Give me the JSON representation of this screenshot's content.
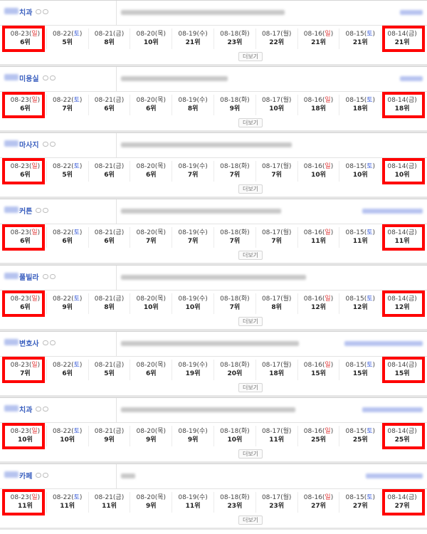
{
  "dates": [
    {
      "md": "08-23",
      "dow": "일",
      "type": "sun"
    },
    {
      "md": "08-22",
      "dow": "토",
      "type": "sat"
    },
    {
      "md": "08-21",
      "dow": "금",
      "type": "weekday"
    },
    {
      "md": "08-20",
      "dow": "목",
      "type": "weekday"
    },
    {
      "md": "08-19",
      "dow": "수",
      "type": "weekday"
    },
    {
      "md": "08-18",
      "dow": "화",
      "type": "weekday"
    },
    {
      "md": "08-17",
      "dow": "월",
      "type": "weekday"
    },
    {
      "md": "08-16",
      "dow": "일",
      "type": "sun"
    },
    {
      "md": "08-15",
      "dow": "토",
      "type": "sat"
    },
    {
      "md": "08-14",
      "dow": "금",
      "type": "weekday"
    }
  ],
  "more_label": "더보기",
  "blocks": [
    {
      "keyword": "치과",
      "ranks": [
        "6위",
        "5위",
        "8위",
        "10위",
        "21위",
        "23위",
        "22위",
        "21위",
        "21위",
        "21위"
      ]
    },
    {
      "keyword": "미용실",
      "ranks": [
        "6위",
        "7위",
        "6위",
        "6위",
        "8위",
        "9위",
        "10위",
        "18위",
        "18위",
        "18위"
      ]
    },
    {
      "keyword": "마사지",
      "ranks": [
        "6위",
        "5위",
        "6위",
        "6위",
        "7위",
        "7위",
        "7위",
        "10위",
        "10위",
        "10위"
      ]
    },
    {
      "keyword": "커튼",
      "ranks": [
        "6위",
        "6위",
        "6위",
        "7위",
        "7위",
        "7위",
        "7위",
        "11위",
        "11위",
        "11위"
      ]
    },
    {
      "keyword": "풀빌라",
      "ranks": [
        "6위",
        "9위",
        "8위",
        "10위",
        "10위",
        "7위",
        "8위",
        "12위",
        "12위",
        "12위"
      ]
    },
    {
      "keyword": "변호사",
      "ranks": [
        "7위",
        "6위",
        "5위",
        "6위",
        "19위",
        "20위",
        "18위",
        "15위",
        "15위",
        "15위"
      ]
    },
    {
      "keyword": "치과",
      "ranks": [
        "10위",
        "10위",
        "9위",
        "9위",
        "9위",
        "10위",
        "11위",
        "25위",
        "25위",
        "25위"
      ]
    },
    {
      "keyword": "카페",
      "ranks": [
        "11위",
        "11위",
        "11위",
        "9위",
        "11위",
        "23위",
        "23위",
        "27위",
        "27위",
        "27위"
      ]
    }
  ],
  "colors": {
    "highlight": "#ff0000",
    "sunday": "#e03b3b",
    "saturday": "#3b5dd8",
    "keyword": "#3a5fbf"
  }
}
